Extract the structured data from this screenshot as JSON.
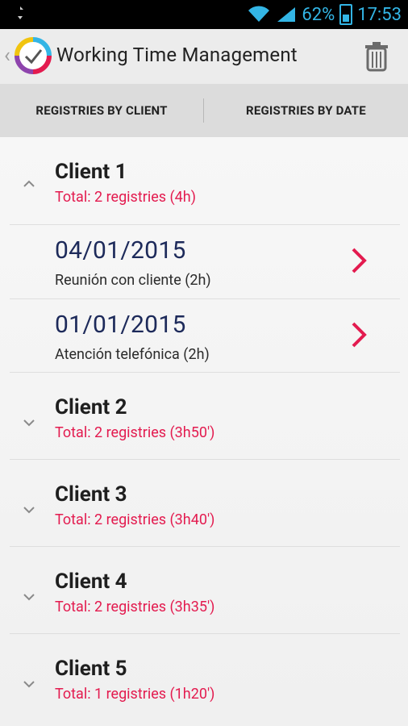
{
  "status_bar": {
    "battery_percent": "62%",
    "time": "17:53",
    "icons": [
      "usb-icon",
      "wifi-icon",
      "signal-icon",
      "battery-icon"
    ]
  },
  "action_bar": {
    "title": "Working Time Management",
    "icons": [
      "back-chevron-icon",
      "app-logo-icon",
      "trash-icon"
    ]
  },
  "tabs": [
    {
      "label": "REGISTRIES BY CLIENT",
      "active": true
    },
    {
      "label": "REGISTRIES BY DATE",
      "active": false
    }
  ],
  "groups": [
    {
      "client": "Client 1",
      "total": "Total: 2 registries (4h)",
      "expanded": true,
      "registries": [
        {
          "date": "04/01/2015",
          "description": "Reunión con cliente (2h)"
        },
        {
          "date": "01/01/2015",
          "description": "Atención telefónica (2h)"
        }
      ]
    },
    {
      "client": "Client 2",
      "total": "Total: 2 registries (3h50')",
      "expanded": false
    },
    {
      "client": "Client 3",
      "total": "Total: 2 registries (3h40')",
      "expanded": false
    },
    {
      "client": "Client 4",
      "total": "Total: 2 registries (3h35')",
      "expanded": false
    },
    {
      "client": "Client 5",
      "total": "Total: 1 registries (1h20')",
      "expanded": false
    }
  ],
  "colors": {
    "accent_blue": "#33b5e5",
    "accent_red": "#e31b4f",
    "date_navy": "#1d2a5a"
  }
}
